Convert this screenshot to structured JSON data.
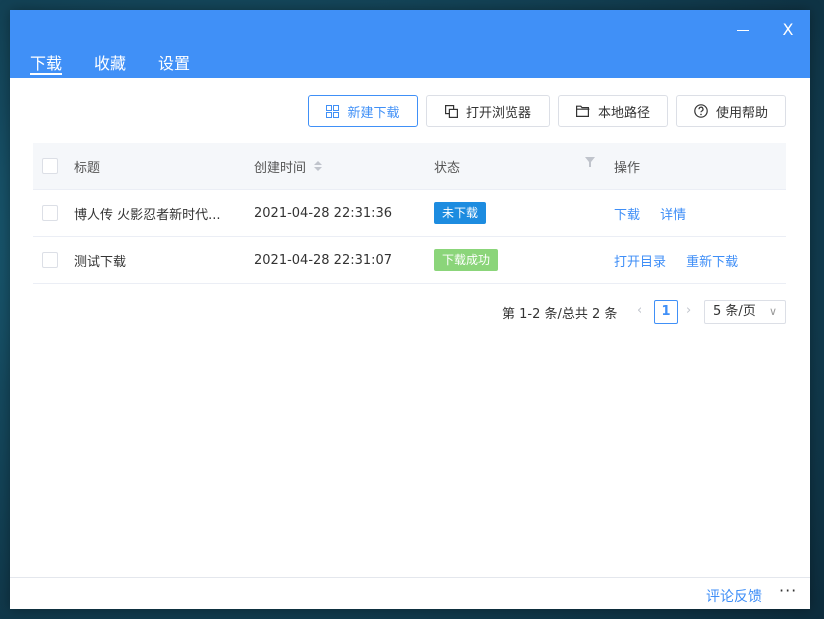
{
  "window": {
    "tabs": [
      {
        "label": "下载",
        "active": true
      },
      {
        "label": "收藏",
        "active": false
      },
      {
        "label": "设置",
        "active": false
      }
    ],
    "close_glyph": "X"
  },
  "toolbar": {
    "new_download": "新建下载",
    "open_browser": "打开浏览器",
    "local_path": "本地路径",
    "help": "使用帮助"
  },
  "table": {
    "headers": {
      "title": "标题",
      "created": "创建时间",
      "status": "状态",
      "actions": "操作"
    },
    "rows": [
      {
        "title": "博人传 火影忍者新时代...",
        "created": "2021-04-28 22:31:36",
        "status": "未下载",
        "status_color": "#1d8ce0",
        "actions": [
          "下载",
          "详情"
        ]
      },
      {
        "title": "测试下载",
        "created": "2021-04-28 22:31:07",
        "status": "下载成功",
        "status_color": "#8bd57a",
        "actions": [
          "打开目录",
          "重新下载"
        ]
      }
    ]
  },
  "pagination": {
    "summary": "第 1-2 条/总共 2 条",
    "current_page": "1",
    "page_size": "5 条/页"
  },
  "footer": {
    "feedback": "评论反馈",
    "more": "···"
  },
  "colors": {
    "accent": "#4090f7",
    "link": "#3e8ef7"
  }
}
